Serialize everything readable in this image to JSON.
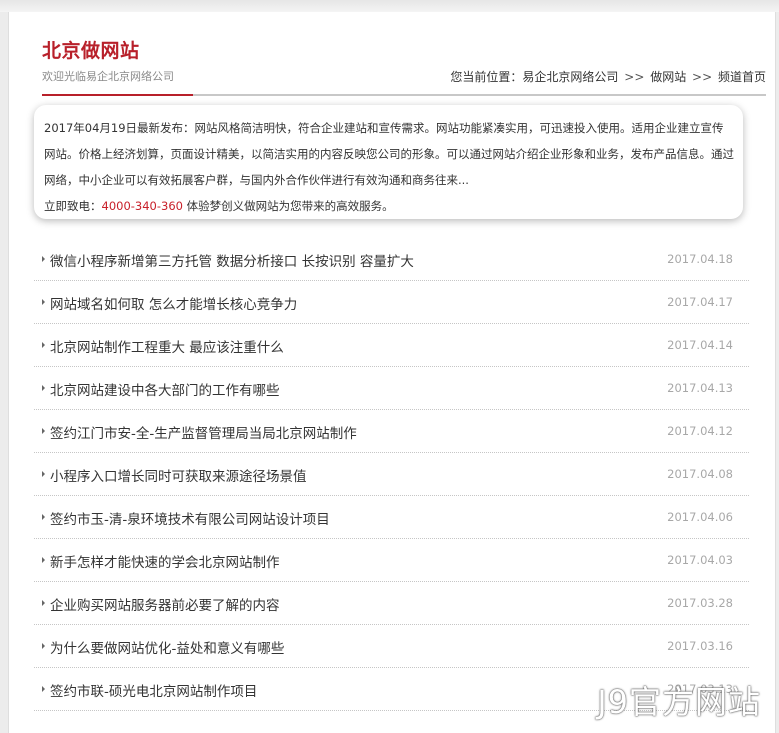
{
  "site": {
    "title": "北京做网站",
    "subtitle": "欢迎光临易企北京网络公司"
  },
  "breadcrumb": {
    "prefix": "您当前位置：",
    "items": [
      "易企北京网络公司",
      "做网站",
      "频道首页"
    ],
    "separator": ">>"
  },
  "intro": {
    "text": "2017年04月19日最新发布：网站风格简洁明快，符合企业建站和宣传需求。网站功能紧凑实用，可迅速投入使用。适用企业建立宣传网站。价格上经济划算，页面设计精美，以简洁实用的内容反映您公司的形象。可以通过网站介绍企业形象和业务，发布产品信息。通过网络，中小企业可以有效拓展客户群，与国内外合作伙伴进行有效沟通和商务往来...",
    "call_label": "立即致电：",
    "phone": "4000-340-360",
    "call_suffix": " 体验梦创义做网站为您带来的高效服务。"
  },
  "articles": [
    {
      "title": "微信小程序新增第三方托管 数据分析接口 长按识别 容量扩大",
      "date": "2017.04.18"
    },
    {
      "title": "网站域名如何取 怎么才能增长核心竞争力",
      "date": "2017.04.17"
    },
    {
      "title": "北京网站制作工程重大 最应该注重什么",
      "date": "2017.04.14"
    },
    {
      "title": "北京网站建设中各大部门的工作有哪些",
      "date": "2017.04.13"
    },
    {
      "title": "签约江门市安-全-生产监督管理局当局北京网站制作",
      "date": "2017.04.12"
    },
    {
      "title": "小程序入口增长同时可获取来源途径场景值",
      "date": "2017.04.08"
    },
    {
      "title": "签约市玉-清-泉环境技术有限公司网站设计项目",
      "date": "2017.04.06"
    },
    {
      "title": "新手怎样才能快速的学会北京网站制作",
      "date": "2017.04.03"
    },
    {
      "title": "企业购买网站服务器前必要了解的内容",
      "date": "2017.03.28"
    },
    {
      "title": "为什么要做网站优化-益处和意义有哪些",
      "date": "2017.03.16"
    },
    {
      "title": "签约市联-硕光电北京网站制作项目",
      "date": "2017.03.13"
    }
  ],
  "watermark": "J9官方网站",
  "colors": {
    "accent": "#b8202a",
    "phone": "#c8202a",
    "date": "#a8a8a8"
  }
}
